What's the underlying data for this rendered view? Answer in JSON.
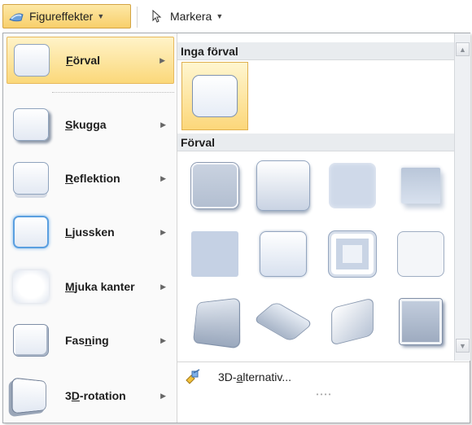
{
  "toolbar": {
    "figureffekter_label": "Figureffekter",
    "markera_label": "Markera"
  },
  "menu": {
    "items": [
      {
        "label": "Förval",
        "key": "F",
        "rest": "örval"
      },
      {
        "label": "Skugga",
        "key": "S",
        "rest": "kugga"
      },
      {
        "label": "Reflektion",
        "key": "R",
        "rest": "eflektion"
      },
      {
        "label": "Ljussken",
        "key": "L",
        "rest": "jussken"
      },
      {
        "label": "Mjuka kanter",
        "key": "M",
        "rest": "juka kanter"
      },
      {
        "label": "Fasning",
        "pre": "Fas",
        "key": "n",
        "rest": "ing"
      },
      {
        "label": "3D-rotation",
        "pre": "3",
        "key": "D",
        "rest": "-rotation"
      }
    ]
  },
  "gallery": {
    "section_none": "Inga förval",
    "section_presets": "Förval"
  },
  "footer": {
    "options_label": "3D-alternativ...",
    "options_pre": "3D-",
    "options_key": "a",
    "options_rest": "lternativ..."
  },
  "colors": {
    "highlight": "#fbd87a",
    "header_bg": "#e9ecef",
    "shape_fill": "#c7d3e6"
  }
}
